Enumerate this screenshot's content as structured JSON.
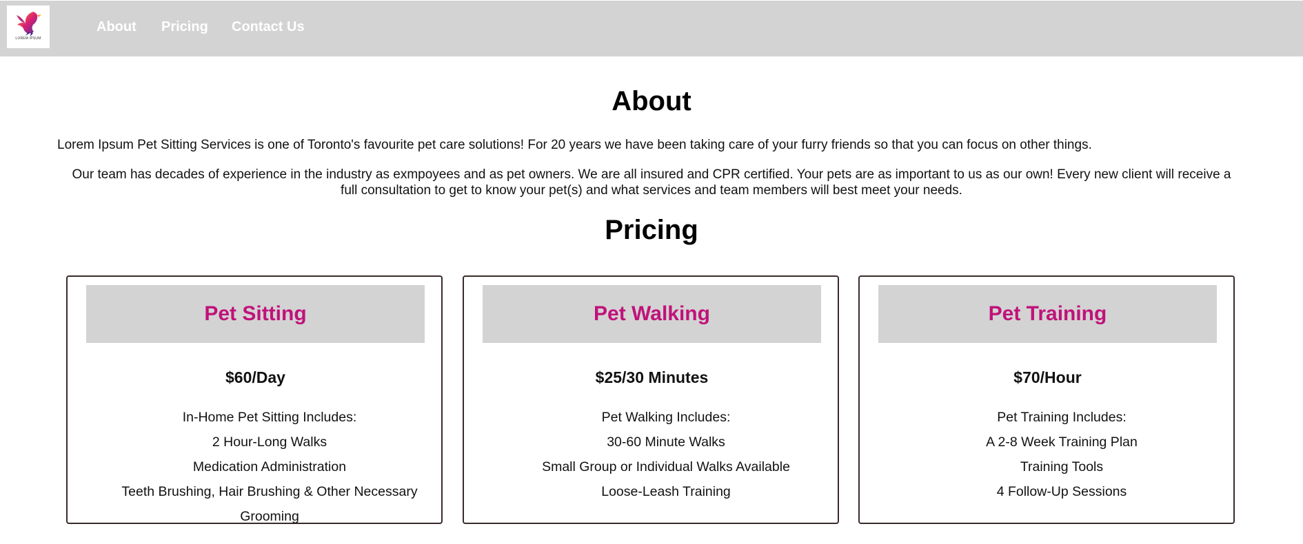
{
  "nav": {
    "logo_text": "LOREM IPSUM",
    "links": [
      "About",
      "Pricing",
      "Contact Us"
    ]
  },
  "about": {
    "title": "About",
    "paragraph1": "Lorem Ipsum Pet Sitting Services is one of Toronto's favourite pet care solutions! For 20 years we have been taking care of your furry friends so that you can focus on other things.",
    "paragraph2": "Our team has decades of experience in the industry as exmpoyees and as pet owners. We are all insured and CPR certified. Your pets are as important to us as our own! Every new client will receive a full consultation to get to know your pet(s) and what services and team members will best meet your needs."
  },
  "pricing": {
    "title": "Pricing",
    "cards": [
      {
        "title": "Pet Sitting",
        "price": "$60/Day",
        "items": [
          "In-Home Pet Sitting Includes:",
          "2 Hour-Long Walks",
          "Medication Administration",
          "Teeth Brushing, Hair Brushing & Other Necessary Grooming"
        ]
      },
      {
        "title": "Pet Walking",
        "price": "$25/30 Minutes",
        "items": [
          "Pet Walking Includes:",
          "30-60 Minute Walks",
          "Small Group or Individual Walks Available",
          "Loose-Leash Training"
        ]
      },
      {
        "title": "Pet Training",
        "price": "$70/Hour",
        "items": [
          "Pet Training Includes:",
          "A 2-8 Week Training Plan",
          "Training Tools",
          "4 Follow-Up Sessions"
        ]
      }
    ]
  },
  "colors": {
    "nav_bg": "#d3d3d3",
    "card_title": "#c0127a",
    "card_header_bg": "#d3d3d3"
  }
}
